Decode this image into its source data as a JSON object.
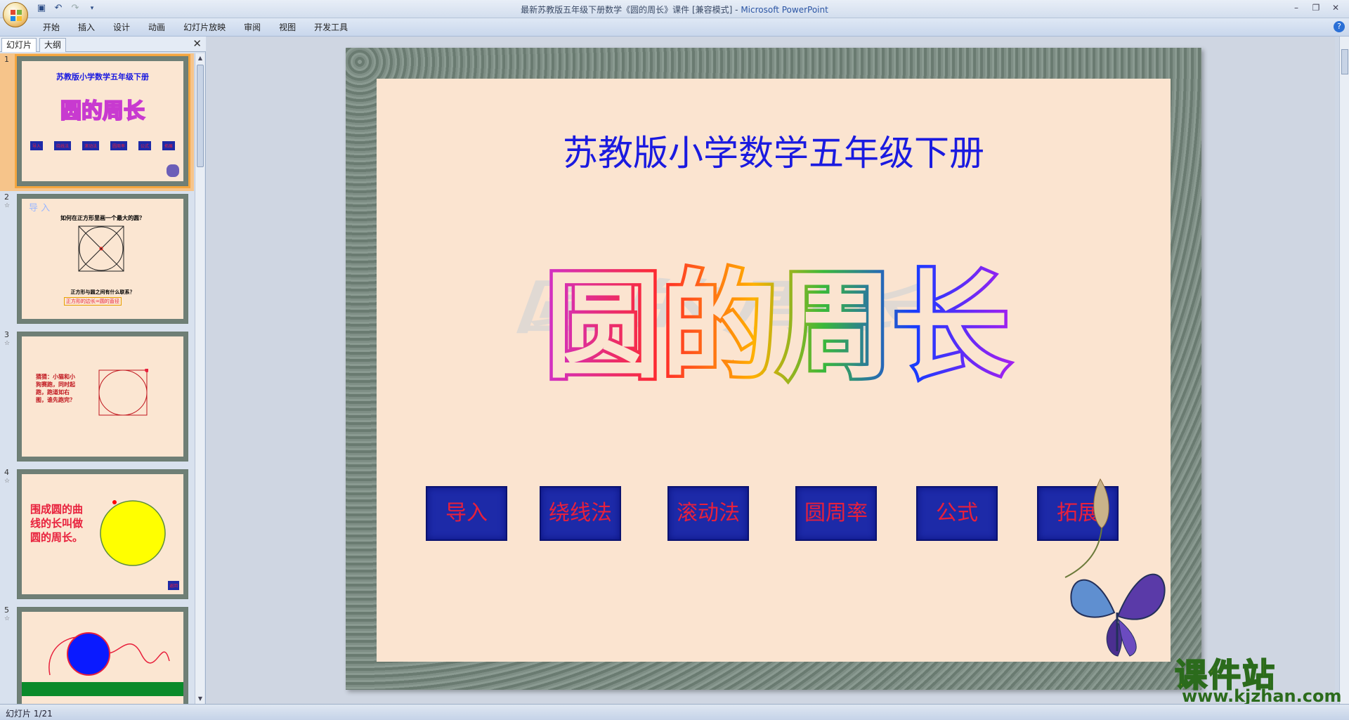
{
  "window": {
    "title": "最新苏教版五年级下册数学《圆的周长》课件 [兼容模式] - ",
    "app_name": "Microsoft PowerPoint"
  },
  "ribbon": {
    "tabs": [
      "开始",
      "插入",
      "设计",
      "动画",
      "幻灯片放映",
      "审阅",
      "视图",
      "开发工具"
    ]
  },
  "left_pane": {
    "tab_slides": "幻灯片",
    "tab_outline": "大纲",
    "thumbnails": [
      {
        "num": "1",
        "title": "苏教版小学数学五年级下册",
        "big": "圆的周长",
        "buttons": [
          "导入",
          "绕线法",
          "滚动法",
          "圆周率",
          "公式",
          "拓展"
        ]
      },
      {
        "num": "2",
        "heading": "导 入",
        "question": "如何在正方形里画一个最大的圆？",
        "q2": "正方形与圆之间有什么联系？",
        "answer": "正方形的边长=圆的直径"
      },
      {
        "num": "3",
        "text": "猜猜：小猫和小狗赛跑，同时起跑，跑道如右图，谁先跑完？"
      },
      {
        "num": "4",
        "text": "围成圆的曲线的长叫做圆的周长。",
        "btn": "返回"
      },
      {
        "num": "5"
      }
    ]
  },
  "slide": {
    "title": "苏教版小学数学五年级下册",
    "big_title": "圆的周长",
    "nav_buttons": [
      "导入",
      "绕线法",
      "滚动法",
      "圆周率",
      "公式",
      "拓展"
    ]
  },
  "watermark": {
    "title": "课件站",
    "url": "www.kjzhan.com"
  },
  "status": {
    "slide_counter": "幻灯片 1/21"
  },
  "colors": {
    "slide_bg": "#fbe4d0",
    "title_blue": "#1a1ae0",
    "button_bg": "#1d2aa8",
    "button_text": "#e8203c"
  }
}
